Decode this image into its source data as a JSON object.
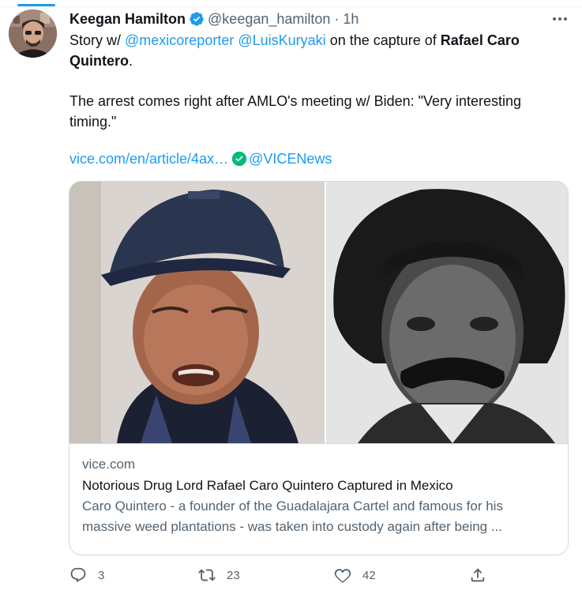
{
  "tweet": {
    "author_name": "Keegan Hamilton",
    "author_handle": "@keegan_hamilton",
    "separator": "·",
    "timestamp": "1h",
    "line1_prefix": "Story w/ ",
    "mention1": "@mexicoreporter",
    "mention2": "@LuisKuryaki",
    "line1_mid": " on the capture  of ",
    "bold_name": "Rafael Caro Quintero",
    "line1_end": ".",
    "paragraph2": "The arrest comes right after AMLO's meeting w/ Biden: \"Very interesting timing.\"",
    "link_text": "vice.com/en/article/4ax…",
    "link_mention": "@VICENews"
  },
  "card": {
    "domain": "vice.com",
    "title": "Notorious Drug Lord Rafael Caro Quintero Captured in Mexico",
    "description": "Caro Quintero - a founder of the Guadalajara Cartel and famous for his massive weed plantations - was taken into custody again after being ..."
  },
  "actions": {
    "replies": "3",
    "retweets": "23",
    "likes": "42"
  },
  "icons": {
    "verified": "verified-badge-icon",
    "more": "more-dots-icon",
    "reply": "reply-icon",
    "retweet": "retweet-icon",
    "like": "heart-icon",
    "share": "share-icon"
  },
  "colors": {
    "accent": "#1d9bf0",
    "text": "#0f1419",
    "secondary": "#536471",
    "border": "#cfd9de"
  }
}
